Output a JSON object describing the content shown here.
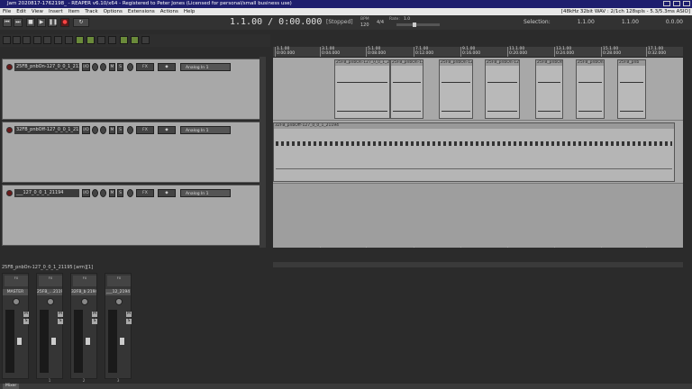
{
  "window": {
    "title": "Jam 2020817-1762198_ - REAPER v6.10/x64 - Registered to Peter Jones (Licensed for personal/small business use)",
    "info": "[48kHz 32bit WAV : 2/1ch 128spls - 5.3/5.3ms ASIO]"
  },
  "menu": [
    "File",
    "Edit",
    "View",
    "Insert",
    "Item",
    "Track",
    "Options",
    "Extensions",
    "Actions",
    "Help"
  ],
  "transport": {
    "position": "1.1.00 / 0:00.000",
    "state": "[Stopped]",
    "bpm_label": "BPM",
    "bpm": "120",
    "time_sig": "4/4",
    "rate_label": "Rate:",
    "rate": "1.0",
    "selection_label": "Selection:",
    "sel_start": "1.1.00",
    "sel_end": "1.1.00",
    "sel_len": "0.0.00"
  },
  "ruler": {
    "ticks": [
      {
        "bar": "1.1.00",
        "time": "0:00.000"
      },
      {
        "bar": "3.1.00",
        "time": "0:04.000"
      },
      {
        "bar": "5.1.00",
        "time": "0:08.000"
      },
      {
        "bar": "7.1.00",
        "time": "0:12.000"
      },
      {
        "bar": "9.1.00",
        "time": "0:16.000"
      },
      {
        "bar": "11.1.00",
        "time": "0:20.000"
      },
      {
        "bar": "13.1.00",
        "time": "0:24.000"
      },
      {
        "bar": "15.1.00",
        "time": "0:28.000"
      },
      {
        "bar": "17.1.00",
        "time": "0:32.000"
      }
    ]
  },
  "tracks": [
    {
      "name": "25FB_pnbOn-127_0_0_1_21195",
      "input": "Analog In 1",
      "io_label": "I/O"
    },
    {
      "name": "32FB_pnbOff-127_0_0_1_21194",
      "input": "Analog In 1",
      "io_label": "I/O"
    },
    {
      "name": "___127_0_0_1_21194",
      "input": "Analog In 1",
      "io_label": "I/O"
    }
  ],
  "items": {
    "lane1": [
      "25FB_pnbOn-127_0_0_1_21195",
      "25FB_pnbOn-12",
      "25FB_pnbOn-127_0_0",
      "25FB_pnbOn-12",
      "25FB_pnbOn-127",
      "25FB_pnbOn",
      "25FB_pnb"
    ],
    "lane2": [
      "32FB_pnbOff-127_0_0_1_21194"
    ]
  },
  "status": "25FB_pnbOn-127_0_0_1_21195 [arm][1]",
  "mixer": {
    "strips": [
      {
        "name": "MASTER",
        "fx": "FX",
        "num": ""
      },
      {
        "name": "25FB_...2119",
        "fx": "FX",
        "num": "1"
      },
      {
        "name": "32FB_b 2194",
        "fx": "FX",
        "num": "2"
      },
      {
        "name": "___12_2194",
        "fx": "FX",
        "num": "3"
      }
    ],
    "tab_label": "Mixer"
  }
}
